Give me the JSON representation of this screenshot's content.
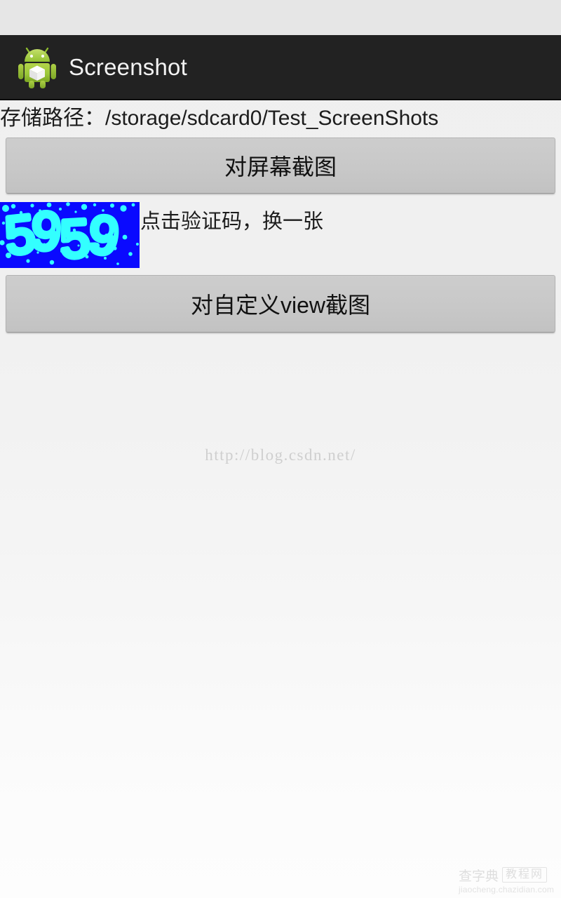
{
  "app": {
    "title": "Screenshot",
    "icon": "android-robot-icon",
    "action_bar_bg": "#222222",
    "background_top": "#efefef",
    "background_bottom": "#fdfdfd"
  },
  "status_bar": {
    "background": "#e6e6e6"
  },
  "path": {
    "label": "存储路径：/storage/sdcard0/Test_ScreenShots"
  },
  "buttons": {
    "screen_capture": "对屏幕截图",
    "view_capture": "对自定义view截图",
    "face_color": "#c8c8c8",
    "text_color": "#111111"
  },
  "captcha": {
    "code": "5959",
    "hint": "点击验证码，换一张",
    "background": "#0a0aff",
    "text_color": "#33ffff",
    "width": 199,
    "height": 94
  },
  "watermarks": {
    "blog": "http://blog.csdn.net/",
    "site_cn": "查字典",
    "site_badge": "教程网",
    "site_url": "jiaocheng.chazidian.com"
  }
}
